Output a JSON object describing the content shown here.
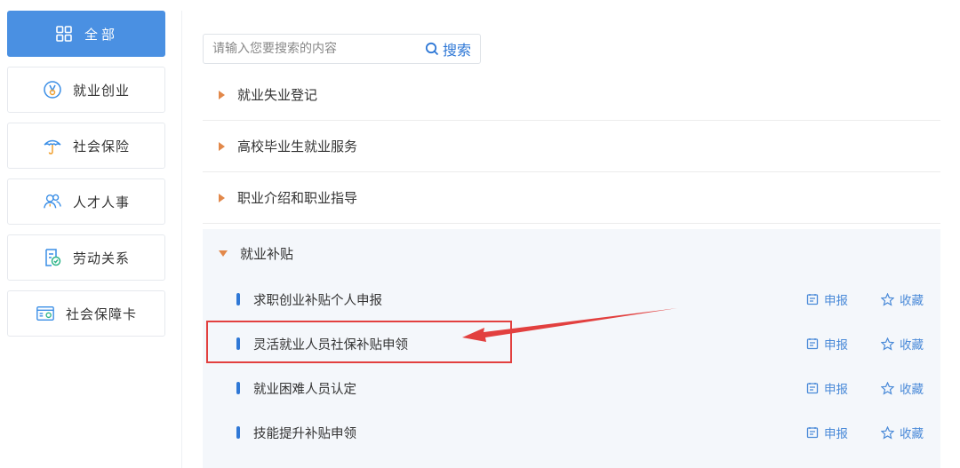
{
  "sidebar": {
    "items": [
      {
        "label": "全部",
        "icon": "grid-icon",
        "active": true
      },
      {
        "label": "就业创业",
        "icon": "medal-icon",
        "active": false
      },
      {
        "label": "社会保险",
        "icon": "umbrella-icon",
        "active": false
      },
      {
        "label": "人才人事",
        "icon": "people-icon",
        "active": false
      },
      {
        "label": "劳动关系",
        "icon": "document-badge-icon",
        "active": false
      },
      {
        "label": "社会保障卡",
        "icon": "card-icon",
        "active": false
      }
    ]
  },
  "search": {
    "placeholder": "请输入您要搜索的内容",
    "button_label": "搜索"
  },
  "categories": [
    {
      "label": "就业失业登记"
    },
    {
      "label": "高校毕业生就业服务"
    },
    {
      "label": "职业介绍和职业指导"
    }
  ],
  "expanded_category": {
    "label": "就业补贴",
    "items": [
      {
        "label": "求职创业补贴个人申报",
        "apply_label": "申报",
        "fav_label": "收藏"
      },
      {
        "label": "灵活就业人员社保补贴申领",
        "apply_label": "申报",
        "fav_label": "收藏"
      },
      {
        "label": "就业困难人员认定",
        "apply_label": "申报",
        "fav_label": "收藏"
      },
      {
        "label": "技能提升补贴申领",
        "apply_label": "申报",
        "fav_label": "收藏"
      }
    ]
  },
  "colors": {
    "accent": "#4a90e2",
    "link": "#2f78d6",
    "triangle": "#e2884a",
    "annotation": "#e2403f"
  }
}
